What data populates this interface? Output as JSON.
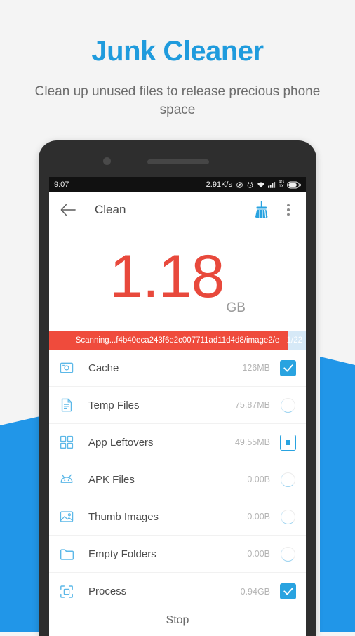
{
  "promo": {
    "title": "Junk Cleaner",
    "subtitle": "Clean up unused files to release precious phone space",
    "title_color": "#1f9bdd",
    "accent_blue": "#2196e8"
  },
  "status_bar": {
    "time": "9:07",
    "net_speed": "2.91K/s",
    "mute_icon": "mute-icon",
    "alarm_icon": "alarm-icon",
    "wifi_icon": "wifi-icon",
    "signal_icon": "signal-bars-icon",
    "network_label": "4G\n1X",
    "network_top": "4G",
    "network_bottom": "1X",
    "battery_icon": "battery-icon"
  },
  "app_bar": {
    "back_icon": "back-arrow-icon",
    "title": "Clean",
    "broom_icon": "broom-icon",
    "menu_icon": "overflow-menu-icon"
  },
  "hero": {
    "value": "1.18",
    "unit": "GB",
    "value_color": "#e8493c"
  },
  "scan": {
    "text": "Scanning...f4b40eca243f6e2c007711ad11d4d8/image2/e",
    "count": "1/22",
    "progress_percent": 93,
    "fill_color": "#ef4b3c",
    "track_color": "#d6e9f7"
  },
  "list": {
    "items": [
      {
        "icon": "cache-icon",
        "label": "Cache",
        "size": "126MB",
        "control": "checked"
      },
      {
        "icon": "temp-files-icon",
        "label": "Temp Files",
        "size": "75.87MB",
        "control": "spinner"
      },
      {
        "icon": "app-leftovers-icon",
        "label": "App Leftovers",
        "size": "49.55MB",
        "control": "partial"
      },
      {
        "icon": "apk-files-icon",
        "label": "APK Files",
        "size": "0.00B",
        "control": "spinner"
      },
      {
        "icon": "thumb-images-icon",
        "label": "Thumb Images",
        "size": "0.00B",
        "control": "spinner"
      },
      {
        "icon": "empty-folders-icon",
        "label": "Empty Folders",
        "size": "0.00B",
        "control": "spinner"
      },
      {
        "icon": "process-icon",
        "label": "Process",
        "size": "0.94GB",
        "control": "checked"
      }
    ]
  },
  "footer": {
    "stop_label": "Stop"
  }
}
